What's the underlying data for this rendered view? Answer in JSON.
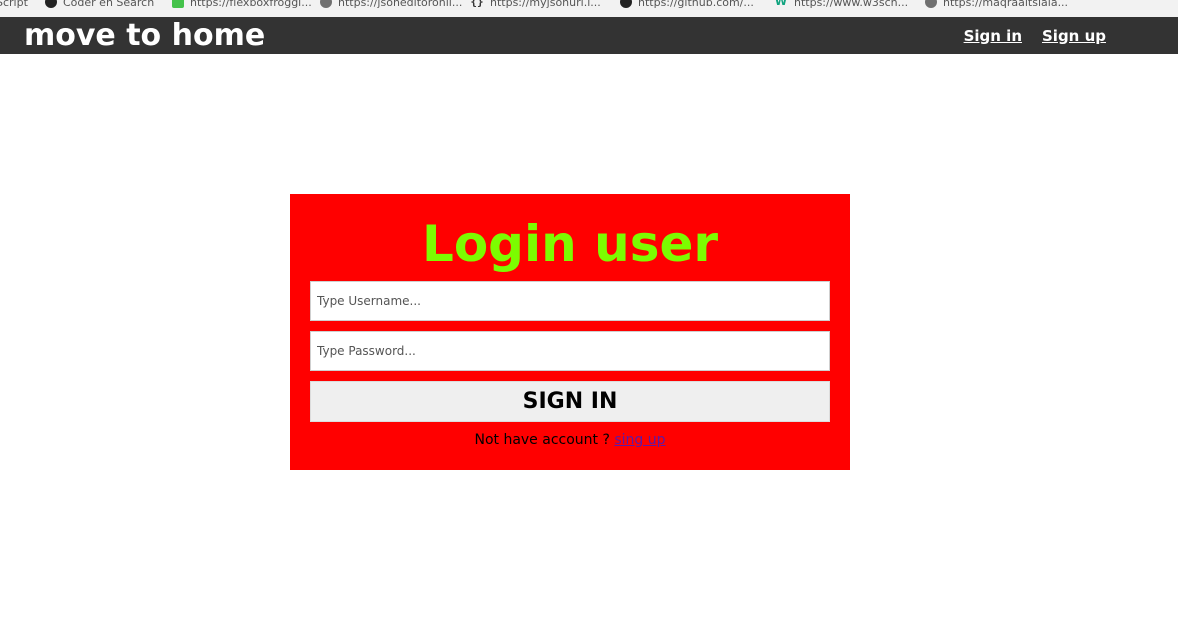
{
  "bookmarks": [
    {
      "label": "Script",
      "icon": "none-icon"
    },
    {
      "label": "Coder en Search",
      "icon": "diamond-icon"
    },
    {
      "label": "https://flexboxfroggi...",
      "icon": "green-square-icon"
    },
    {
      "label": "https://jsoneditoronli...",
      "icon": "globe-icon"
    },
    {
      "label": "https://myjsonurl.i...",
      "icon": "braces-icon"
    },
    {
      "label": "https://github.com/...",
      "icon": "github-icon"
    },
    {
      "label": "https://www.w3sch...",
      "icon": "w-icon"
    },
    {
      "label": "https://maqraaltslala...",
      "icon": "globe-icon"
    }
  ],
  "navbar": {
    "brand": "move to home",
    "links": [
      {
        "label": "Sign in"
      },
      {
        "label": "Sign up"
      }
    ]
  },
  "login": {
    "title": "Login user",
    "username": {
      "placeholder": "Type Username...",
      "value": ""
    },
    "password": {
      "placeholder": "Type Password...",
      "value": ""
    },
    "submit_label": "SIGN IN",
    "prompt_text": "Not have account ?",
    "signup_link_label": "sing up"
  },
  "colors": {
    "navbar_bg": "#333333",
    "card_bg": "#ff0000",
    "title_color": "#7cfc00",
    "button_bg": "#efefef",
    "link_color": "#5b1aa8"
  }
}
